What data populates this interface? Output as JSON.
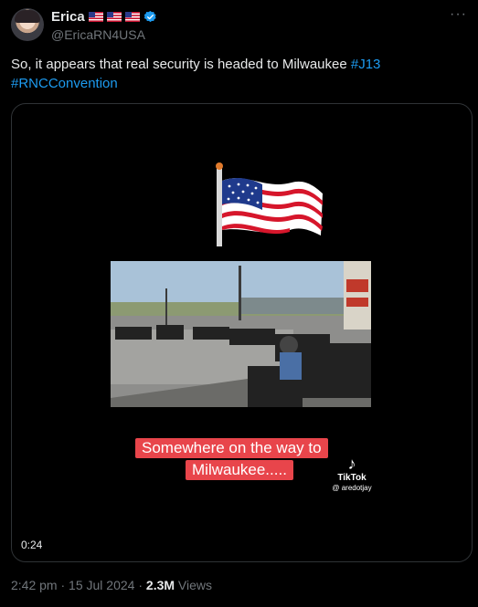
{
  "author": {
    "name": "Erica",
    "handle": "@EricaRN4USA",
    "flags": [
      "flag-us-icon",
      "flag-us-icon",
      "flag-us-icon"
    ],
    "verified_color": "#1d9bf0"
  },
  "tweet": {
    "text_plain": "So, it appears that real security is headed to Milwaukee ",
    "hashtag_1": "#J13",
    "hashtag_2": "#RNCConvention"
  },
  "media": {
    "caption_line_1": "Somewhere on the way to",
    "caption_line_2": "Milwaukee.....",
    "tiktok_label": "TikTok",
    "tiktok_user": "@ aredotjay",
    "duration": "0:24"
  },
  "meta": {
    "time": "2:42 pm",
    "separator": "·",
    "date": "15 Jul 2024",
    "views_count": "2.3M",
    "views_label": "Views"
  },
  "colors": {
    "background": "#000000",
    "text": "#e7e9ea",
    "secondary": "#71767b",
    "link": "#1d9bf0",
    "caption_bg": "#e8454b"
  }
}
